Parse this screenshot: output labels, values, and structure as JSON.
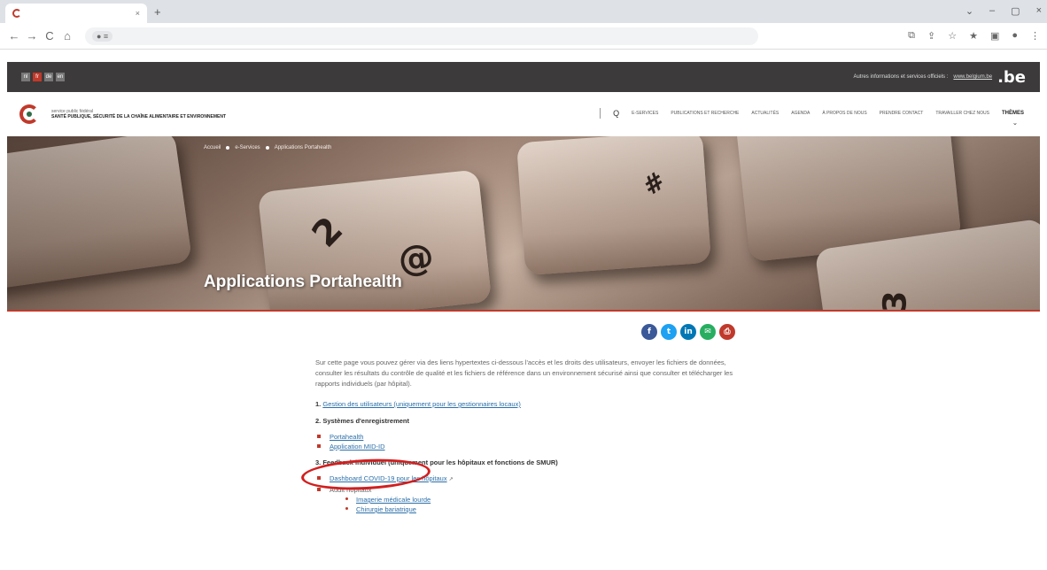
{
  "browser": {
    "tab_title": "",
    "tab_close": "×",
    "new_tab": "+",
    "window_controls": [
      "⌄",
      "–",
      "▢",
      "×"
    ],
    "nav": [
      "←",
      "→",
      "C",
      "⌂"
    ],
    "address": "",
    "toolbar_icons": [
      "⧉",
      "⇪",
      "☆",
      "★",
      "▣",
      "●",
      "⋮"
    ]
  },
  "govbar": {
    "languages": [
      "nl",
      "fr",
      "de",
      "en"
    ],
    "active_language": "fr",
    "info_text": "Autres informations et services officiels :",
    "info_link": "www.belgium.be",
    "be_logo": ".be"
  },
  "header": {
    "org_line1": "service public fédéral",
    "org_line2": "SANTÉ PUBLIQUE, SÉCURITÉ DE LA CHAÎNE ALIMENTAIRE ET ENVIRONNEMENT",
    "search_icon": "Q",
    "nav": [
      "E-SERVICES",
      "PUBLICATIONS ET RECHERCHE",
      "ACTUALITÉS",
      "AGENDA",
      "À PROPOS DE NOUS",
      "PRENDRE CONTACT",
      "TRAVAILLER CHEZ NOUS"
    ],
    "themes": "THÈMES",
    "themes_chevron": "⌄"
  },
  "hero": {
    "breadcrumb": [
      "Accueil",
      "e-Services",
      "Applications Portahealth"
    ],
    "title": "Applications Portahealth",
    "key_glyphs": [
      "2",
      "@",
      "#",
      "3"
    ]
  },
  "share": {
    "icons": [
      {
        "name": "facebook-icon",
        "glyph": "f",
        "color": "#3b5998"
      },
      {
        "name": "twitter-icon",
        "glyph": "t",
        "color": "#1da1f2"
      },
      {
        "name": "linkedin-icon",
        "glyph": "in",
        "color": "#0077b5"
      },
      {
        "name": "email-icon",
        "glyph": "✉",
        "color": "#27ae60"
      },
      {
        "name": "print-icon",
        "glyph": "⎙",
        "color": "#c0392b"
      }
    ]
  },
  "content": {
    "intro": "Sur cette page vous pouvez gérer via des liens hypertextes ci-dessous l'accès et les droits des utilisateurs, envoyer les fichiers de données, consulter les résultats du contrôle de qualité et les fichiers de référence dans un environnement sécurisé ainsi que consulter et télécharger les rapports individuels (par hôpital).",
    "section1_num": "1.",
    "section1_link": "Gestion des utilisateurs (uniquement pour les gestionnaires locaux)",
    "section2": "2. Systèmes d'enregistrement",
    "section2_items": [
      "Portahealth",
      "Application MID-ID"
    ],
    "section3": "3. Feedback individuel (uniquement pour les hôpitaux et fonctions de SMUR)",
    "section3_item1": "Dashboard COVID-19 pour les hôpitaux",
    "section3_item2": "Audit hôpitaux",
    "section3_subitems": [
      "Imagerie médicale lourde",
      "Chirurgie bariatrique"
    ]
  }
}
